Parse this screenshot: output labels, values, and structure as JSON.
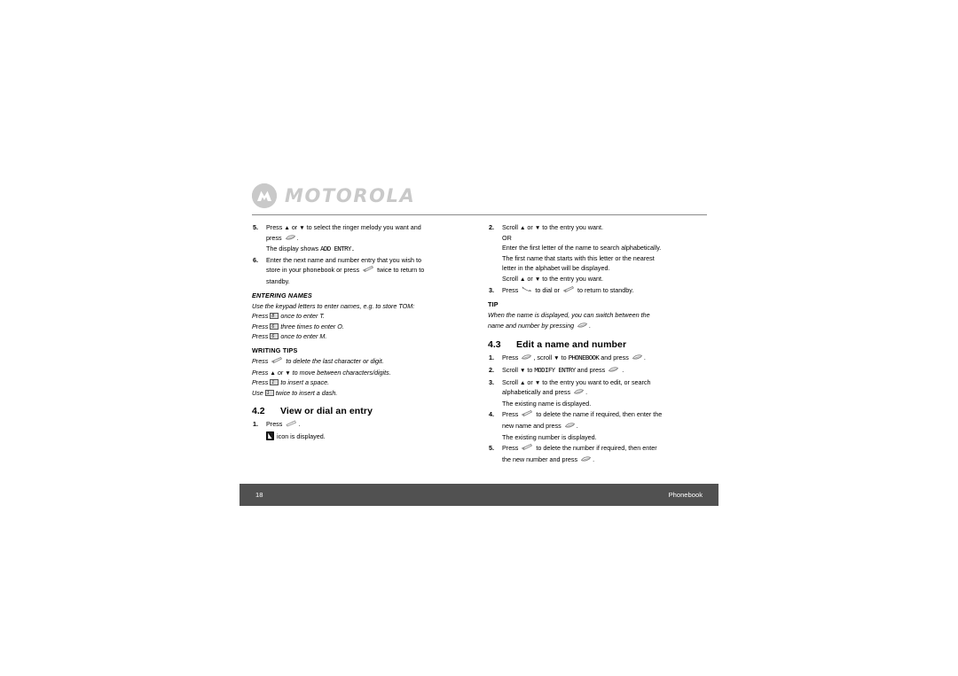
{
  "brand": {
    "logo_text": "MOTOROLA",
    "logo_color": "#c9c9c9"
  },
  "footer": {
    "page_number": "18",
    "section_name": "Phonebook",
    "background": "#515151",
    "text_color": "#ffffff"
  },
  "left_column": {
    "steps": [
      {
        "num": "5.",
        "line1_a": "Press",
        "line1_up": "▲",
        "line1_b": "or",
        "line1_dn": "▼",
        "line1_c": "to select the ringer melody you want and",
        "line2_a": "press",
        "line2_key": "menu-select-key",
        "line2_b": ".",
        "sub": "The display shows",
        "sub_lcd": "ADD ENTRY."
      },
      {
        "num": "6.",
        "line1": "Enter the next name and number entry that you wish to",
        "line2_a": "store in your phonebook or press",
        "line2_key": "back-delete-key",
        "line2_b": "twice to return to",
        "line3": "standby."
      }
    ],
    "entering_names": {
      "heading": "ENTERING NAMES",
      "intro": "Use the keypad letters to enter names, e.g. to store TOM:",
      "lines": [
        {
          "press": "Press",
          "keycap": "8",
          "text": "once to enter T."
        },
        {
          "press": "Press",
          "keycap": "6",
          "text": "three times to enter O."
        },
        {
          "press": "Press",
          "keycap": "6",
          "text": "once to enter M."
        }
      ]
    },
    "writing_tips": {
      "heading": "WRITING TIPS",
      "lines": [
        {
          "lead": "Press",
          "icon": "back-delete-key",
          "text": "to delete the last character or digit."
        },
        {
          "lead": "Press",
          "arrows": true,
          "up": "▲",
          "or": "or",
          "dn": "▼",
          "text": "to move between characters/digits."
        },
        {
          "lead": "Press",
          "keycap": "1",
          "text": "to insert a space."
        },
        {
          "lead": "Use",
          "keycap": "1",
          "text": "twice to insert a dash."
        }
      ]
    },
    "section_4_2": {
      "number": "4.2",
      "title": "View or dial an entry",
      "step1_num": "1.",
      "step1_a": "Press",
      "step1_key": "phonebook-key",
      "step1_b": ".",
      "sub_icon": "phonebook-display-icon",
      "sub_text": "icon is displayed."
    }
  },
  "right_column": {
    "steps": [
      {
        "num": "2.",
        "line1_a": "Scroll",
        "line1_up": "▲",
        "line1_b": "or",
        "line1_dn": "▼",
        "line1_c": "to the entry you want.",
        "or_line": "OR",
        "sub_lines": [
          "Enter the first letter of the name to search alphabetically.",
          "The first name that starts with this letter or the nearest",
          "letter in the alphabet will be displayed."
        ],
        "last_a": "Scroll",
        "last_up": "▲",
        "last_b": "or",
        "last_dn": "▼",
        "last_c": "to the entry you want."
      },
      {
        "num": "3.",
        "line_a": "Press",
        "key1": "call-key",
        "line_b": "to dial or",
        "key2": "back-delete-key",
        "line_c": "to return to standby."
      }
    ],
    "tip": {
      "heading": "TIP",
      "line1": "When the name is displayed, you can switch between the",
      "line2_a": "name and number by pressing",
      "line2_key": "menu-select-key",
      "line2_b": "."
    },
    "section_4_3": {
      "number": "4.3",
      "title": "Edit a name and number",
      "steps": [
        {
          "num": "1.",
          "a": "Press",
          "key1": "menu-select-key",
          "b": ", scroll",
          "dn": "▼",
          "c": "to",
          "lcd": "PHONEBOOK",
          "d": "and press",
          "key2": "menu-select-key",
          "e": "."
        },
        {
          "num": "2.",
          "a": "Scroll",
          "dn": "▼",
          "b": "to",
          "lcd": "MODIFY ENTRY",
          "c": "and press",
          "key1": "menu-select-key",
          "d": "."
        },
        {
          "num": "3.",
          "line1_a": "Scroll",
          "up": "▲",
          "line1_b": "or",
          "dn": "▼",
          "line1_c": "to the entry you want to edit, or search",
          "line2_a": "alphabetically and press",
          "line2_key": "menu-select-key",
          "line2_b": ".",
          "sub": "The existing name is displayed."
        },
        {
          "num": "4.",
          "line1_a": "Press",
          "line1_key": "back-delete-key",
          "line1_b": "to delete the name if required, then enter the",
          "line2_a": "new name and press",
          "line2_key": "menu-select-key",
          "line2_b": ".",
          "sub": "The existing number is displayed."
        },
        {
          "num": "5.",
          "line1_a": "Press",
          "line1_key": "back-delete-key",
          "line1_b": "to delete the number if required, then enter",
          "line2_a": "the new number and press",
          "line2_key": "menu-select-key",
          "line2_b": "."
        }
      ]
    }
  }
}
